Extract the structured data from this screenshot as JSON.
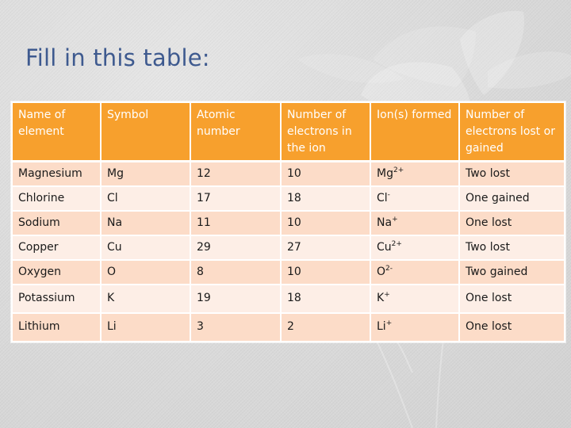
{
  "slide": {
    "title": "Fill in this table:"
  },
  "colors": {
    "title": "#3e5a8f",
    "header_bg": "#f7a02d",
    "row_odd_bg": "#fcdcc8",
    "row_even_bg": "#fdeee6"
  },
  "table": {
    "headers": [
      "Name of element",
      "Symbol",
      "Atomic number",
      "Number of electrons in the ion",
      "Ion(s) formed",
      "Number of electrons lost or gained"
    ],
    "rows": [
      {
        "name": "Magnesium",
        "symbol": "Mg",
        "atomic_number": "12",
        "electrons_in_ion": "10",
        "ion_base": "Mg",
        "ion_charge": "2+",
        "change": "Two lost"
      },
      {
        "name": "Chlorine",
        "symbol": "Cl",
        "atomic_number": "17",
        "electrons_in_ion": "18",
        "ion_base": "Cl",
        "ion_charge": "-",
        "change": "One gained"
      },
      {
        "name": "Sodium",
        "symbol": "Na",
        "atomic_number": "11",
        "electrons_in_ion": "10",
        "ion_base": "Na",
        "ion_charge": "+",
        "change": "One lost"
      },
      {
        "name": "Copper",
        "symbol": "Cu",
        "atomic_number": "29",
        "electrons_in_ion": "27",
        "ion_base": "Cu",
        "ion_charge": "2+",
        "change": "Two lost"
      },
      {
        "name": "Oxygen",
        "symbol": "O",
        "atomic_number": "8",
        "electrons_in_ion": "10",
        "ion_base": "O",
        "ion_charge": "2-",
        "change": "Two gained"
      },
      {
        "name": "Potassium",
        "symbol": "K",
        "atomic_number": "19",
        "electrons_in_ion": "18",
        "ion_base": "K",
        "ion_charge": "+",
        "change": "One lost"
      },
      {
        "name": "Lithium",
        "symbol": "Li",
        "atomic_number": "3",
        "electrons_in_ion": "2",
        "ion_base": "Li",
        "ion_charge": "+",
        "change": "One lost"
      }
    ]
  }
}
